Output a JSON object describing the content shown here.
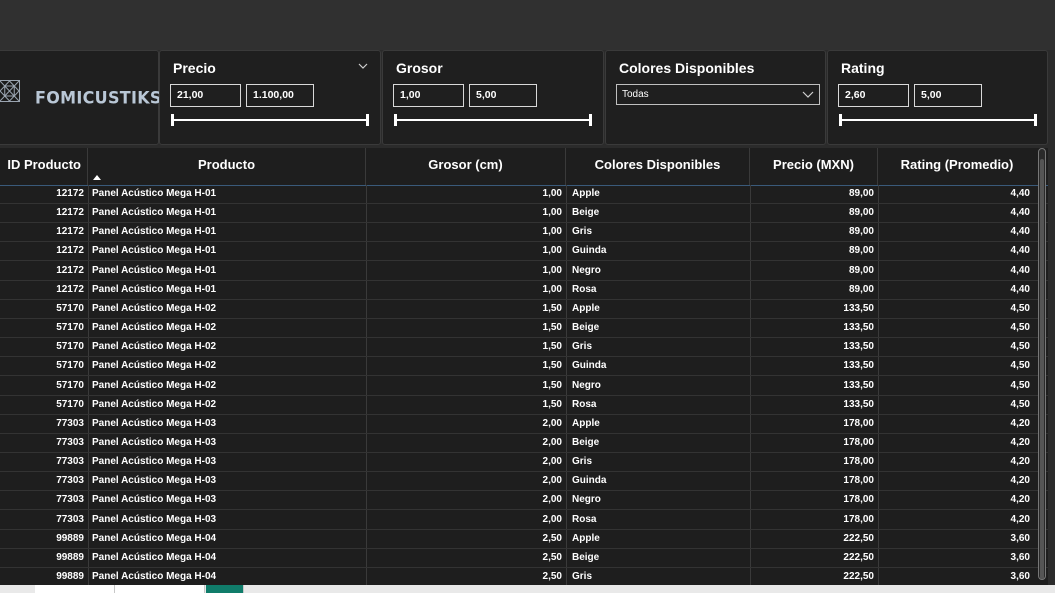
{
  "logo": {
    "text": "FOMICUSTIKS"
  },
  "slicers": {
    "precio": {
      "title": "Precio",
      "min": "21,00",
      "max": "1.100,00"
    },
    "grosor": {
      "title": "Grosor",
      "min": "1,00",
      "max": "5,00"
    },
    "colores": {
      "title": "Colores Disponibles",
      "selected": "Todas"
    },
    "rating": {
      "title": "Rating",
      "min": "2,60",
      "max": "5,00"
    }
  },
  "table": {
    "headers": {
      "id": "ID Producto",
      "producto": "Producto",
      "grosor": "Grosor (cm)",
      "colores": "Colores Disponibles",
      "precio": "Precio (MXN)",
      "rating": "Rating (Promedio)"
    },
    "rows": [
      {
        "id": "12172",
        "producto": "Panel Acústico Mega H-01",
        "grosor": "1,00",
        "color": "Apple",
        "precio": "89,00",
        "rating": "4,40"
      },
      {
        "id": "12172",
        "producto": "Panel Acústico Mega H-01",
        "grosor": "1,00",
        "color": "Beige",
        "precio": "89,00",
        "rating": "4,40"
      },
      {
        "id": "12172",
        "producto": "Panel Acústico Mega H-01",
        "grosor": "1,00",
        "color": "Gris",
        "precio": "89,00",
        "rating": "4,40"
      },
      {
        "id": "12172",
        "producto": "Panel Acústico Mega H-01",
        "grosor": "1,00",
        "color": "Guinda",
        "precio": "89,00",
        "rating": "4,40"
      },
      {
        "id": "12172",
        "producto": "Panel Acústico Mega H-01",
        "grosor": "1,00",
        "color": "Negro",
        "precio": "89,00",
        "rating": "4,40"
      },
      {
        "id": "12172",
        "producto": "Panel Acústico Mega H-01",
        "grosor": "1,00",
        "color": "Rosa",
        "precio": "89,00",
        "rating": "4,40"
      },
      {
        "id": "57170",
        "producto": "Panel Acústico Mega H-02",
        "grosor": "1,50",
        "color": "Apple",
        "precio": "133,50",
        "rating": "4,50"
      },
      {
        "id": "57170",
        "producto": "Panel Acústico Mega H-02",
        "grosor": "1,50",
        "color": "Beige",
        "precio": "133,50",
        "rating": "4,50"
      },
      {
        "id": "57170",
        "producto": "Panel Acústico Mega H-02",
        "grosor": "1,50",
        "color": "Gris",
        "precio": "133,50",
        "rating": "4,50"
      },
      {
        "id": "57170",
        "producto": "Panel Acústico Mega H-02",
        "grosor": "1,50",
        "color": "Guinda",
        "precio": "133,50",
        "rating": "4,50"
      },
      {
        "id": "57170",
        "producto": "Panel Acústico Mega H-02",
        "grosor": "1,50",
        "color": "Negro",
        "precio": "133,50",
        "rating": "4,50"
      },
      {
        "id": "57170",
        "producto": "Panel Acústico Mega H-02",
        "grosor": "1,50",
        "color": "Rosa",
        "precio": "133,50",
        "rating": "4,50"
      },
      {
        "id": "77303",
        "producto": "Panel Acústico Mega H-03",
        "grosor": "2,00",
        "color": "Apple",
        "precio": "178,00",
        "rating": "4,20"
      },
      {
        "id": "77303",
        "producto": "Panel Acústico Mega H-03",
        "grosor": "2,00",
        "color": "Beige",
        "precio": "178,00",
        "rating": "4,20"
      },
      {
        "id": "77303",
        "producto": "Panel Acústico Mega H-03",
        "grosor": "2,00",
        "color": "Gris",
        "precio": "178,00",
        "rating": "4,20"
      },
      {
        "id": "77303",
        "producto": "Panel Acústico Mega H-03",
        "grosor": "2,00",
        "color": "Guinda",
        "precio": "178,00",
        "rating": "4,20"
      },
      {
        "id": "77303",
        "producto": "Panel Acústico Mega H-03",
        "grosor": "2,00",
        "color": "Negro",
        "precio": "178,00",
        "rating": "4,20"
      },
      {
        "id": "77303",
        "producto": "Panel Acústico Mega H-03",
        "grosor": "2,00",
        "color": "Rosa",
        "precio": "178,00",
        "rating": "4,20"
      },
      {
        "id": "99889",
        "producto": "Panel Acústico Mega H-04",
        "grosor": "2,50",
        "color": "Apple",
        "precio": "222,50",
        "rating": "3,60"
      },
      {
        "id": "99889",
        "producto": "Panel Acústico Mega H-04",
        "grosor": "2,50",
        "color": "Beige",
        "precio": "222,50",
        "rating": "3,60"
      },
      {
        "id": "99889",
        "producto": "Panel Acústico Mega H-04",
        "grosor": "2,50",
        "color": "Gris",
        "precio": "222,50",
        "rating": "3,60"
      }
    ]
  },
  "colors": {
    "background": "#2b2b2b",
    "panel": "#1f1f1f",
    "active_tab": "#107c6a"
  }
}
